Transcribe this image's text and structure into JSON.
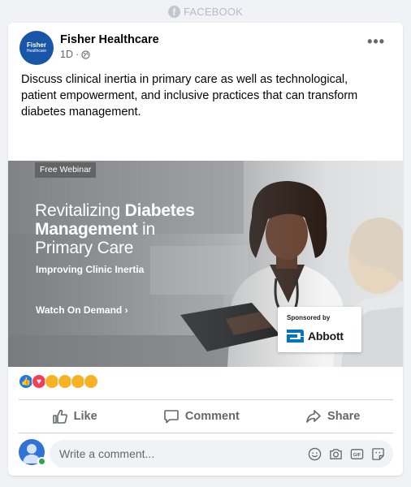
{
  "platform": {
    "label": "FACEBOOK",
    "icon": "facebook-icon"
  },
  "post": {
    "page_name": "Fisher Healthcare",
    "avatar": {
      "line1": "Fisher",
      "line2": "Healthcare"
    },
    "time": "1D",
    "audience_icon": "globe-icon",
    "more_icon": "more-options-icon",
    "text": "Discuss clinical inertia in primary care as well as technological, patient empowerment, and inclusive practices that can transform diabetes management."
  },
  "media": {
    "badge": "Free Webinar",
    "title_line1_regular": "Revitalizing ",
    "title_line1_bold": "Diabetes",
    "title_line2_bold": "Management",
    "title_line2_regular": " in",
    "title_line3": "Primary Care",
    "subtitle": "Improving Clinic Inertia",
    "cta": "Watch On Demand",
    "cta_icon": "chevron-right-icon",
    "sponsor_label": "Sponsored by",
    "sponsor_name": "Abbott"
  },
  "reactions": [
    {
      "name": "like-reaction-icon",
      "color": "#1877f2"
    },
    {
      "name": "love-reaction-icon",
      "color": "#f33e58"
    },
    {
      "name": "care-reaction-icon",
      "color": "#f7b125"
    },
    {
      "name": "haha-reaction-icon",
      "color": "#f7b125"
    },
    {
      "name": "wow-reaction-icon",
      "color": "#f7b125"
    },
    {
      "name": "sad-reaction-icon",
      "color": "#f7b125"
    }
  ],
  "actions": {
    "like": "Like",
    "comment": "Comment",
    "share": "Share"
  },
  "comment_box": {
    "placeholder": "Write a comment...",
    "tools": [
      "emoji-icon",
      "camera-icon",
      "gif-icon",
      "sticker-icon"
    ]
  },
  "colors": {
    "page_bg": "#f0f2f5",
    "text_secondary": "#65676b",
    "brand_blue": "#1a56a8",
    "online_green": "#31a24c"
  }
}
